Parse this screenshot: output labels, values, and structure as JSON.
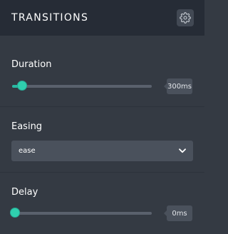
{
  "header": {
    "title": "TRANSITIONS",
    "settings_icon": "gear-icon"
  },
  "duration": {
    "label": "Duration",
    "value_text": "300ms",
    "value": 300,
    "slider_fraction": 0.05
  },
  "easing": {
    "label": "Easing",
    "selected": "ease",
    "chevron_icon": "chevron-down-icon"
  },
  "delay": {
    "label": "Delay",
    "value_text": "0ms",
    "value": 0,
    "slider_fraction": 0.0
  },
  "colors": {
    "accent": "#2fcfae",
    "header_bg": "#262c36",
    "panel_bg": "#343a43",
    "control_bg": "#4a515c"
  }
}
